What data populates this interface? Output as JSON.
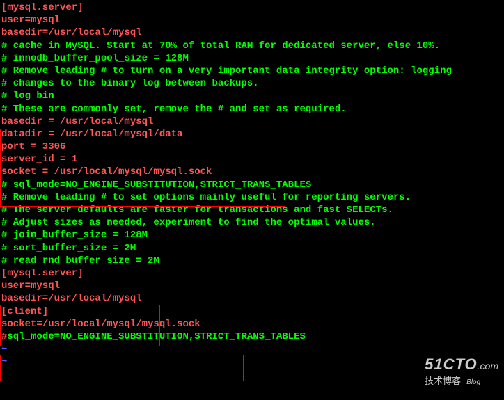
{
  "lines": {
    "l0": "[mysql.server]",
    "l1": "user=mysql",
    "l2": "basedir=/usr/local/mysql",
    "l3": "# cache in MySQL. Start at 70% of total RAM for dedicated server, else 10%.",
    "l4": "# innodb_buffer_pool_size = 128M",
    "l5": "",
    "l6": "# Remove leading # to turn on a very important data integrity option: logging",
    "l7": "# changes to the binary log between backups.",
    "l8": "# log_bin",
    "l9": "",
    "l10": "# These are commonly set, remove the # and set as required.",
    "l11": "basedir = /usr/local/mysql",
    "l12": "datadir = /usr/local/mysql/data",
    "l13": "port = 3306",
    "l14": "server_id = 1",
    "l15": "socket = /usr/local/mysql/mysql.sock",
    "l16": "# sql_mode=NO_ENGINE_SUBSTITUTION,STRICT_TRANS_TABLES",
    "l17": "# Remove leading # to set options mainly useful for reporting servers.",
    "l18": "# The server defaults are faster for transactions and fast SELECTs.",
    "l19": "# Adjust sizes as needed, experiment to find the optimal values.",
    "l20": "# join_buffer_size = 128M",
    "l21": "# sort_buffer_size = 2M",
    "l22": "# read_rnd_buffer_size = 2M",
    "l23": "",
    "l24": "[mysql.server]",
    "l25": "user=mysql",
    "l26": "basedir=/usr/local/mysql",
    "l27": "",
    "l28": "[client]",
    "l29": "socket=/usr/local/mysql/mysql.sock",
    "l30a": "#",
    "l30b": "sql_mode=NO_ENGINE_SUBSTITUTION,STRICT_TRANS_TABLES",
    "l31": "~",
    "l32": "~"
  },
  "watermark": {
    "main": "51CTO",
    "com": ".com",
    "sub": "技术博客",
    "blog": "Blog"
  }
}
